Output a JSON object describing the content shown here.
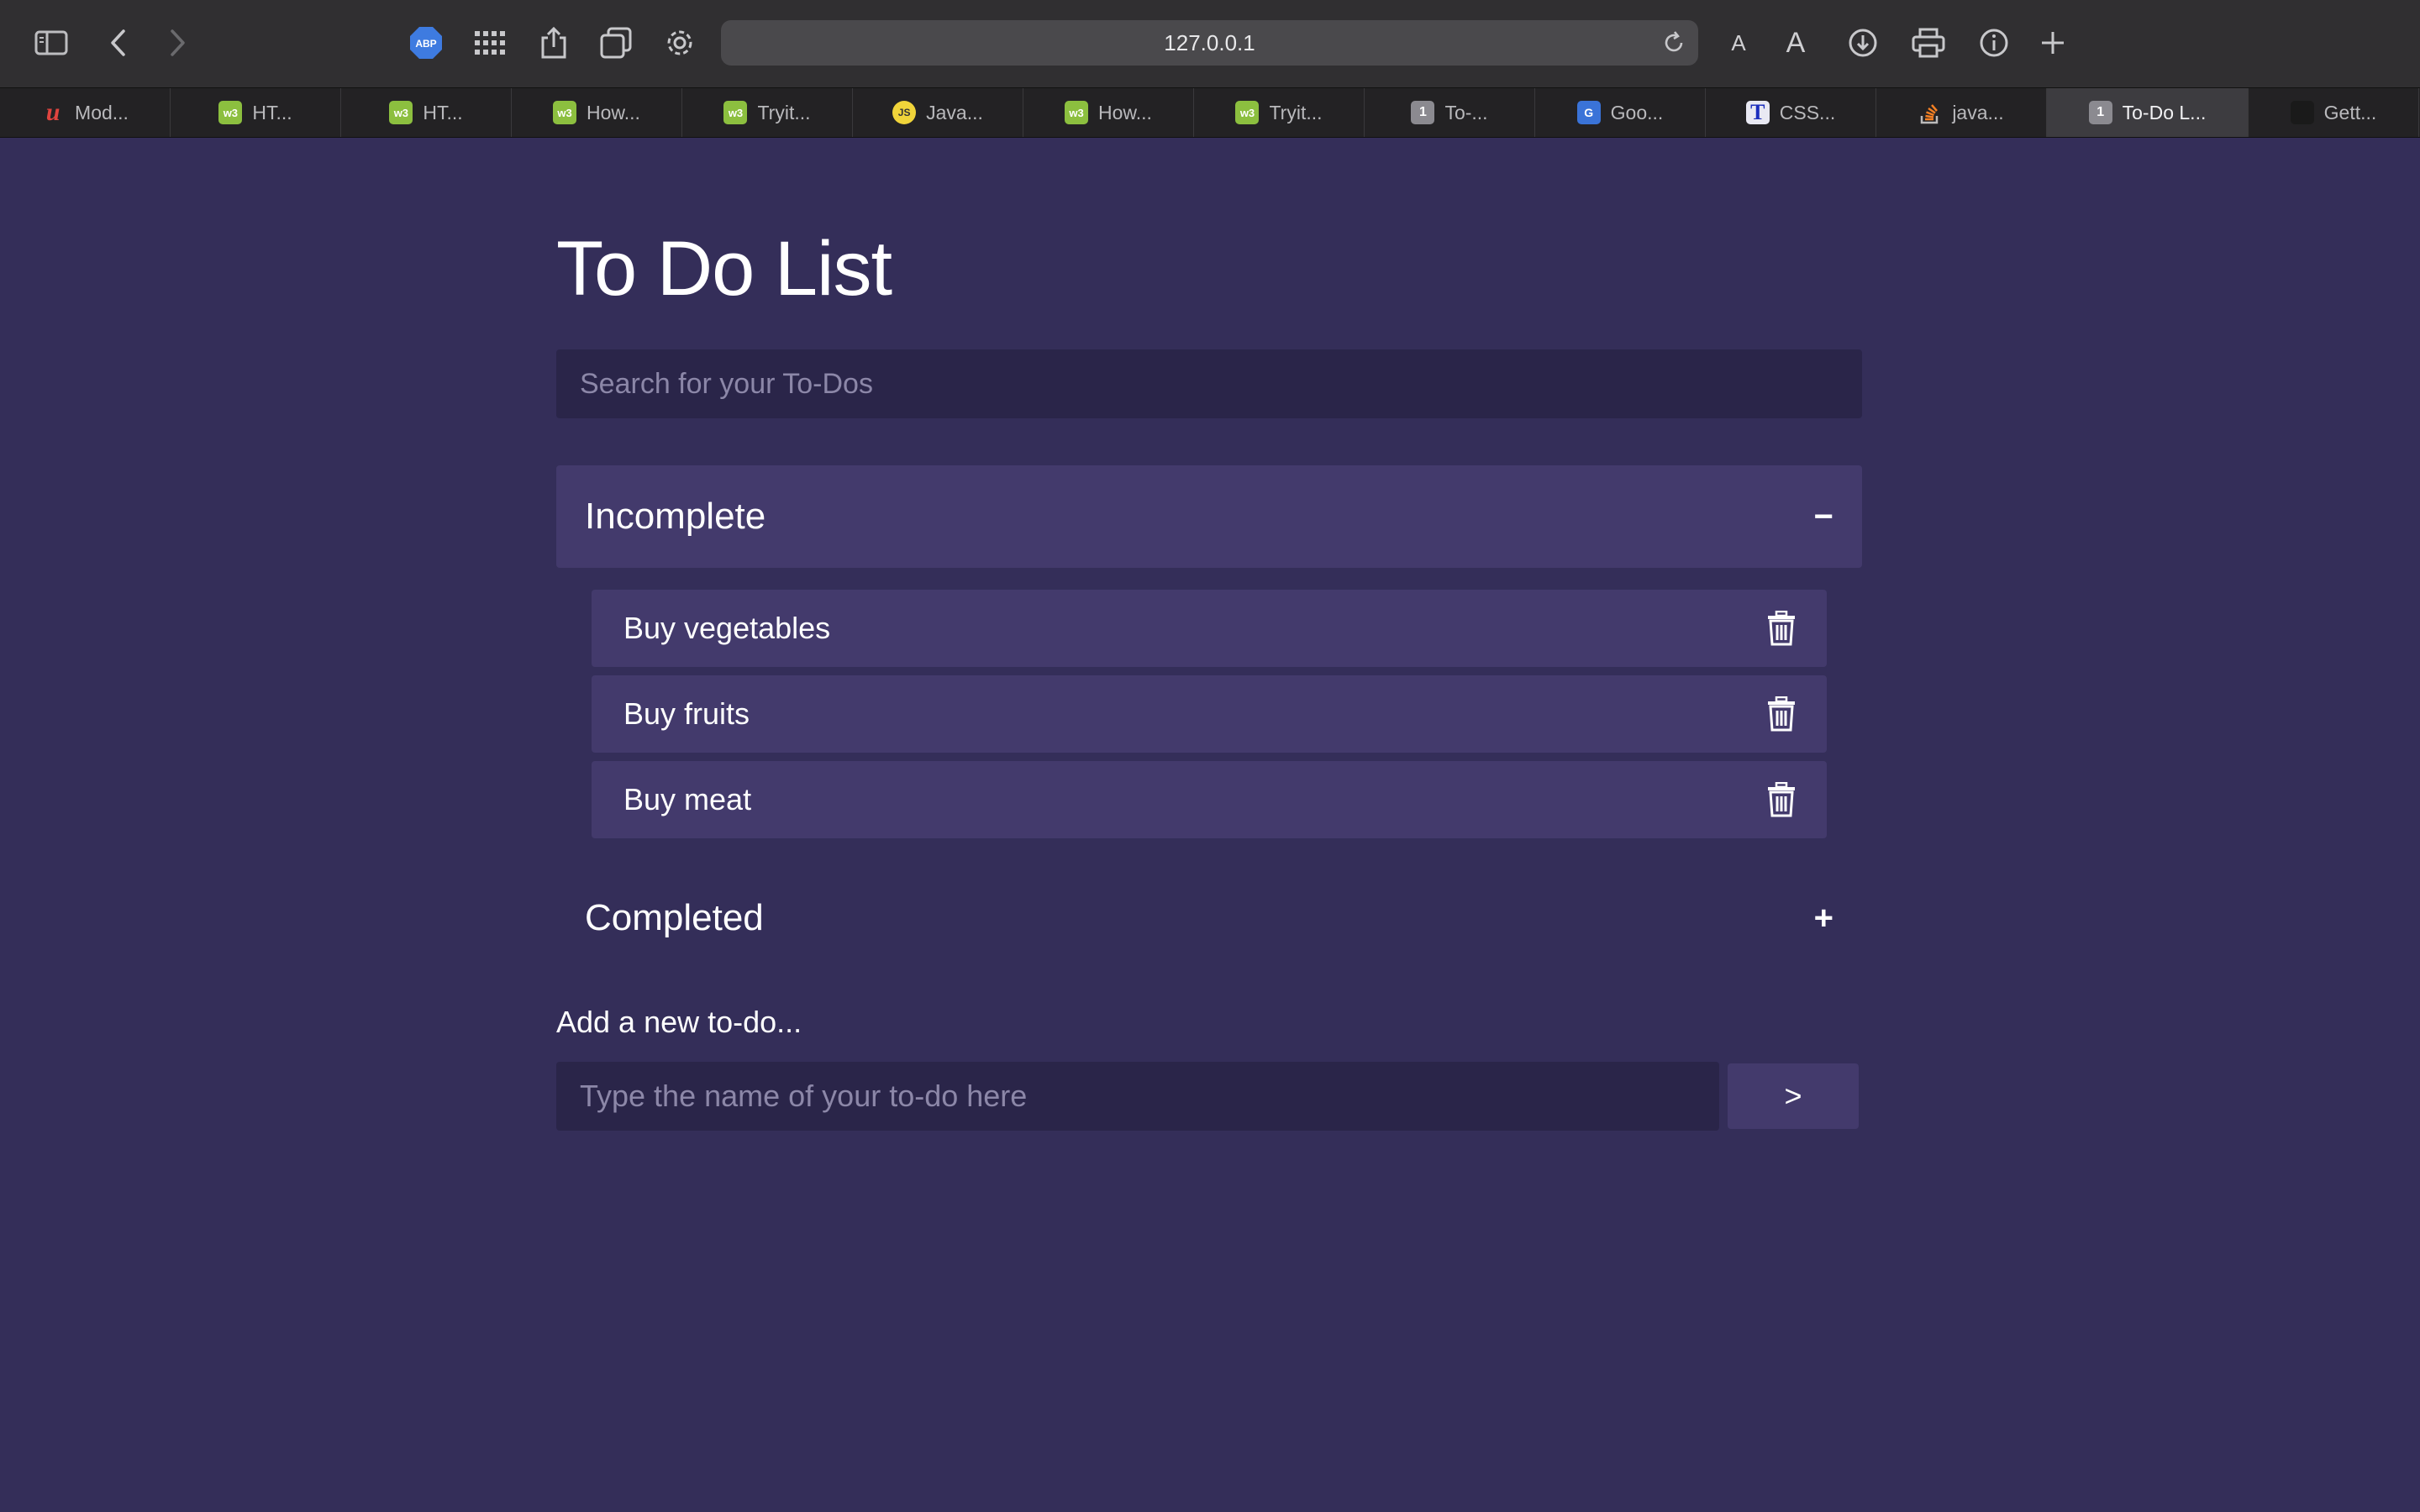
{
  "browser": {
    "url": "127.0.0.1",
    "adblock_label": "ABP",
    "font_small_label": "A",
    "font_large_label": "A",
    "tabs": [
      {
        "title": "Mod...",
        "favicon": "udemy-icon",
        "glyph": "u"
      },
      {
        "title": "HT...",
        "favicon": "w3schools-icon",
        "glyph": "w3"
      },
      {
        "title": "HT...",
        "favicon": "w3schools-icon",
        "glyph": "w3"
      },
      {
        "title": "How...",
        "favicon": "w3schools-icon",
        "glyph": "w3"
      },
      {
        "title": "Tryit...",
        "favicon": "w3schools-icon",
        "glyph": "w3"
      },
      {
        "title": "Java...",
        "favicon": "javascript-icon",
        "glyph": "JS"
      },
      {
        "title": "How...",
        "favicon": "w3schools-icon",
        "glyph": "w3"
      },
      {
        "title": "Tryit...",
        "favicon": "w3schools-icon",
        "glyph": "w3"
      },
      {
        "title": "To-...",
        "favicon": "number-icon",
        "glyph": "1"
      },
      {
        "title": "Goo...",
        "favicon": "google-icon",
        "glyph": "G"
      },
      {
        "title": "CSS...",
        "favicon": "t-icon",
        "glyph": "T"
      },
      {
        "title": "java...",
        "favicon": "stackoverflow-icon",
        "glyph": ""
      },
      {
        "title": "To-Do L...",
        "favicon": "number-icon",
        "glyph": "1",
        "active": true
      },
      {
        "title": "Gett...",
        "favicon": "dark-icon",
        "glyph": ""
      }
    ]
  },
  "page": {
    "title": "To Do List",
    "search_placeholder": "Search for your To-Dos",
    "incomplete": {
      "label": "Incomplete",
      "toggle": "−",
      "items": [
        {
          "text": "Buy vegetables"
        },
        {
          "text": "Buy fruits"
        },
        {
          "text": "Buy meat"
        }
      ]
    },
    "completed": {
      "label": "Completed",
      "toggle": "+"
    },
    "add_label": "Add a new to-do...",
    "new_placeholder": "Type the name of your to-do here",
    "submit_label": ">"
  },
  "colors": {
    "background": "#342e59",
    "card": "#433a6c",
    "input": "#2a2549"
  }
}
